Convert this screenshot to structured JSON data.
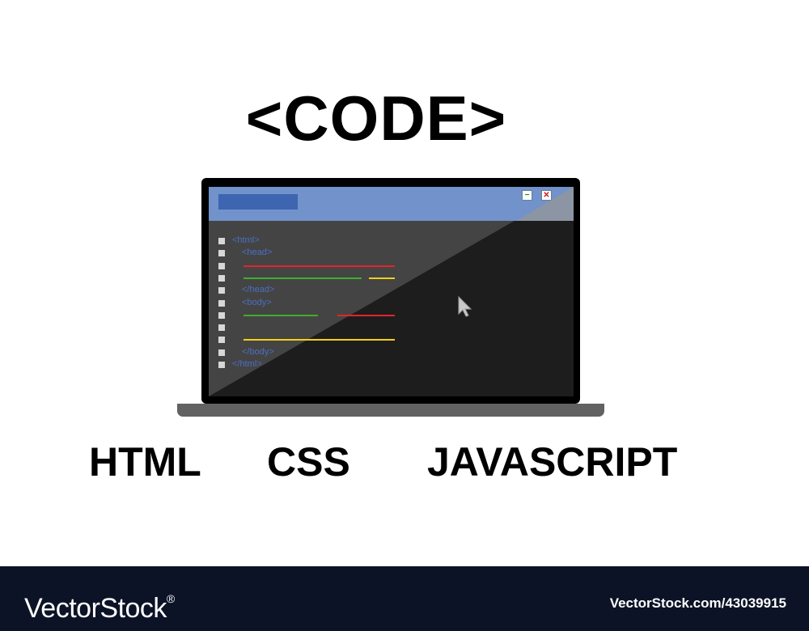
{
  "headline": "<CODE>",
  "code_lines": [
    {
      "tag": "<html>",
      "indent": 0
    },
    {
      "tag": "<head>",
      "indent": 1
    },
    {
      "bars": [
        {
          "color": "#e3242b",
          "length": 1.0
        }
      ]
    },
    {
      "bars": [
        {
          "color": "#3fae2a",
          "length": 0.78
        },
        {
          "color": "#f2d018",
          "length": 0.17
        }
      ]
    },
    {
      "tag": "</head>",
      "indent": 1
    },
    {
      "tag": "<body>",
      "indent": 1
    },
    {
      "bars": [
        {
          "color": "#3fae2a",
          "length": 0.49
        },
        {
          "color": "#e3242b",
          "length": 0.38
        }
      ]
    },
    {
      "bars": []
    },
    {
      "bars": [
        {
          "color": "#f2d018",
          "length": 1.0
        }
      ]
    },
    {
      "tag": "</body>",
      "indent": 1
    },
    {
      "tag": "</html>",
      "indent": 0
    }
  ],
  "window": {
    "minimize_symbol": "−",
    "close_symbol": "✕"
  },
  "cursor_icon": "mouse-pointer-icon",
  "languages": [
    "HTML",
    "CSS",
    "JAVASCRIPT"
  ],
  "footer": {
    "brand": "VectorStock",
    "registered_mark": "®",
    "asset_id": "VectorStock.com/43039915"
  },
  "colors": {
    "titlebar": "#7192cb",
    "tab": "#3e65b0",
    "screen": "#1d1d1d",
    "tag_text": "#4b6fc3",
    "footer": "#0d1326"
  }
}
